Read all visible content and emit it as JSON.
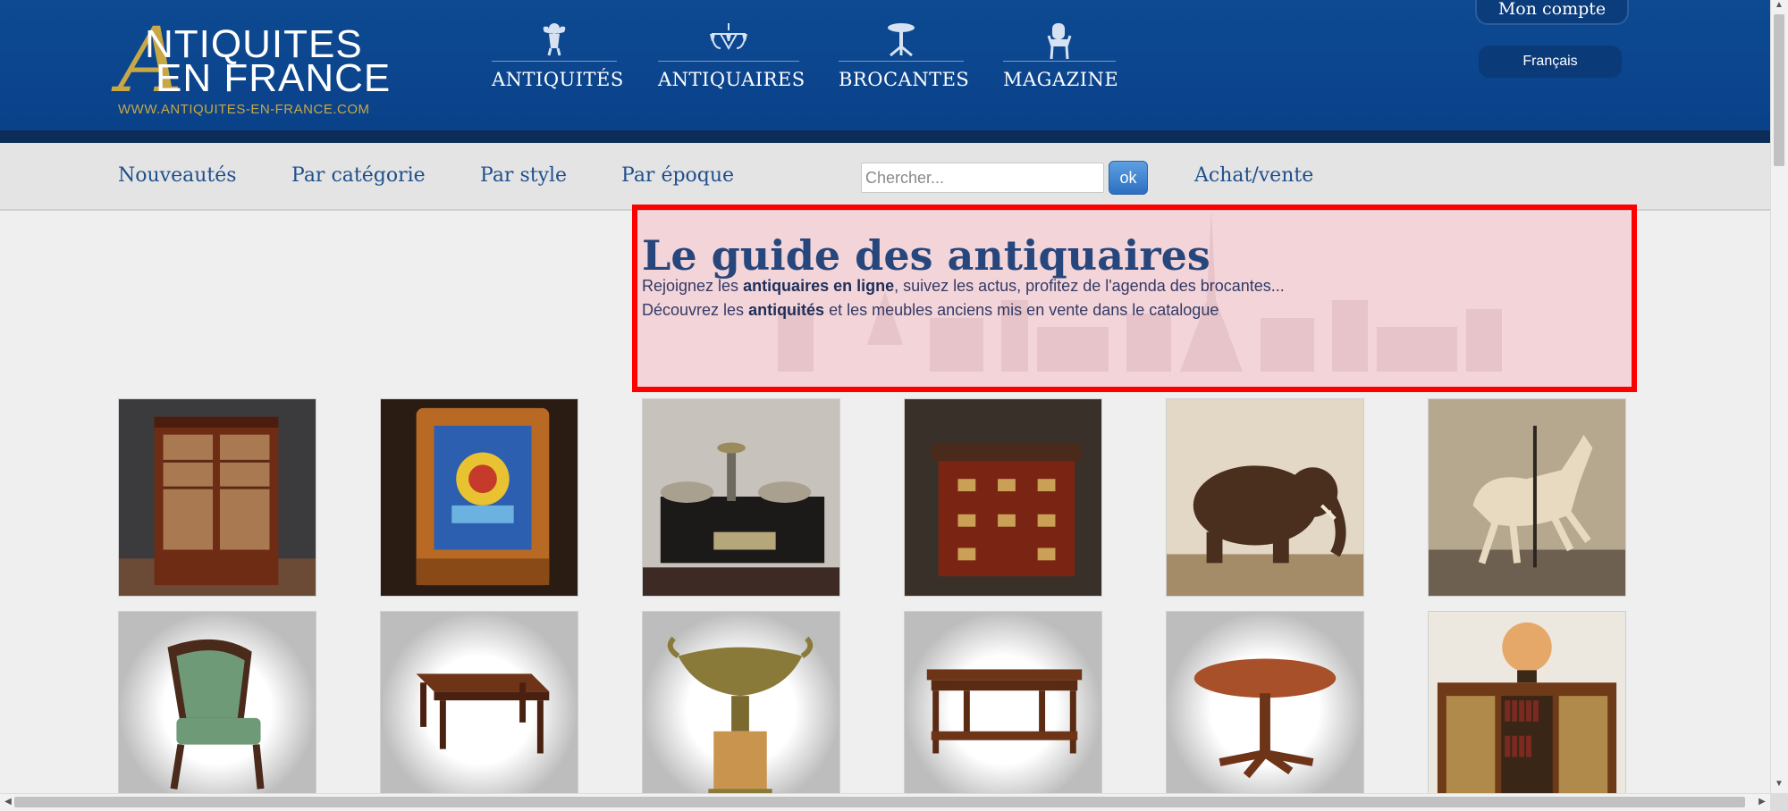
{
  "header": {
    "logo": {
      "big_letter": "A",
      "line1": "NTIQUITES",
      "line2": "EN FRANCE",
      "url": "WWW.ANTIQUITES-EN-FRANCE.COM"
    },
    "main_nav": [
      {
        "label": "ANTIQUITÉS",
        "icon": "cherub-icon"
      },
      {
        "label": "ANTIQUAIRES",
        "icon": "chandelier-icon"
      },
      {
        "label": "BROCANTES",
        "icon": "pedestal-table-icon"
      },
      {
        "label": "MAGAZINE",
        "icon": "chair-icon"
      }
    ],
    "account_label": "Mon compte",
    "language_label": "Français"
  },
  "subnav": {
    "links": [
      "Nouveautés",
      "Par catégorie",
      "Par style",
      "Par époque"
    ],
    "search_placeholder": "Chercher...",
    "search_button": "ok",
    "achat_vente": "Achat/vente"
  },
  "hero": {
    "title": "Le guide des antiquaires",
    "line1": {
      "pre": "Rejoignez les ",
      "bold": "antiquaires en ligne",
      "post": ", suivez les actus, profitez de l'agenda des brocantes..."
    },
    "line2": {
      "pre": "Découvrez les ",
      "bold": "antiquités",
      "post": " et les meubles anciens mis en vente dans le catalogue"
    }
  },
  "products": [
    {
      "name": "bookcase-cabinet-image"
    },
    {
      "name": "pinball-machine-image"
    },
    {
      "name": "brass-scale-image"
    },
    {
      "name": "marquetry-commode-image"
    },
    {
      "name": "bronze-elephant-image"
    },
    {
      "name": "carousel-horse-image"
    },
    {
      "name": "green-armchair-image"
    },
    {
      "name": "mahogany-bench-image"
    },
    {
      "name": "bronze-urn-image"
    },
    {
      "name": "console-table-image"
    },
    {
      "name": "round-pedestal-table-image"
    },
    {
      "name": "bookcase-with-globe-image"
    }
  ],
  "colors": {
    "header_blue": "#0d4a92",
    "nav_link_blue": "#1f4f8c",
    "gold": "#c8a745",
    "highlight_red": "#ff0000"
  }
}
